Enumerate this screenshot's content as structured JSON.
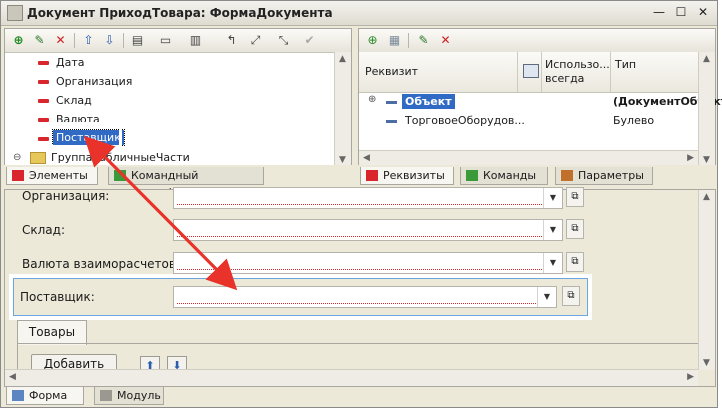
{
  "window": {
    "title": "Документ ПриходТовара: ФормаДокумента",
    "controls": [
      "—",
      "☐",
      "✕"
    ]
  },
  "left_panel": {
    "items": [
      {
        "label": "Дата"
      },
      {
        "label": "Организация"
      },
      {
        "label": "Склад"
      },
      {
        "label": "Валюта"
      },
      {
        "label": "Поставщик",
        "selected": true
      },
      {
        "label": "ГруппаТабличныеЧасти",
        "is_group": true
      }
    ],
    "tabs": [
      {
        "label": "Элементы",
        "active": true
      },
      {
        "label": "Командный интерфейс",
        "active": false
      }
    ]
  },
  "right_panel": {
    "columns": [
      "Реквизит",
      "Использо... всегда",
      "Тип"
    ],
    "column_line2": "всегда",
    "column_line1": "Использо...",
    "rows": [
      {
        "name": "Объект",
        "type": "(ДокументОбъект",
        "expandable": true,
        "selected": true
      },
      {
        "name": "ТорговоеОборудов...",
        "type": "Булево",
        "expandable": false
      }
    ],
    "tabs": [
      {
        "label": "Реквизиты",
        "active": true
      },
      {
        "label": "Команды",
        "active": false
      },
      {
        "label": "Параметры",
        "active": false
      }
    ]
  },
  "form_preview": {
    "fields": [
      {
        "label": "Организация:",
        "value": ""
      },
      {
        "label": "Склад:",
        "value": ""
      },
      {
        "label": "Валюта взаиморасчетов:",
        "value": ""
      },
      {
        "label": "Поставщик:",
        "value": "",
        "highlighted": true
      }
    ],
    "section_tab": "Товары",
    "add_button": "Добавить"
  },
  "bottom_tabs": [
    {
      "label": "Форма",
      "active": true
    },
    {
      "label": "Модуль",
      "active": false
    }
  ],
  "colors": {
    "accent_red": "#d9262c",
    "selection_blue": "#316ac5",
    "arrow_red": "#e8322a"
  }
}
